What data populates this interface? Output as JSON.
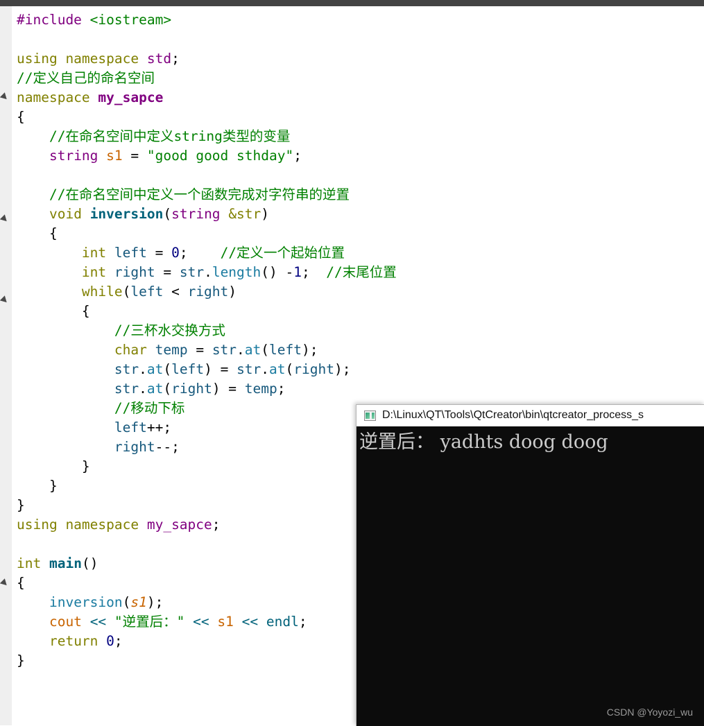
{
  "editor": {
    "background_color": "#ffffff",
    "gutter_color": "#efefef",
    "top_strip_color": "#434343",
    "fold_markers": [
      140,
      316,
      433,
      841
    ],
    "code_lines": [
      {
        "id": "l1",
        "segments": [
          {
            "c": "t-pre",
            "t": "#include"
          },
          {
            "c": "t-op",
            "t": " "
          },
          {
            "c": "t-inc",
            "t": "<iostream>"
          }
        ]
      },
      {
        "id": "l2",
        "segments": []
      },
      {
        "id": "l3",
        "segments": [
          {
            "c": "t-kw",
            "t": "using namespace "
          },
          {
            "c": "t-type",
            "t": "std"
          },
          {
            "c": "t-punc",
            "t": ";"
          }
        ]
      },
      {
        "id": "l4",
        "segments": [
          {
            "c": "t-cmt",
            "t": "//定义自己的命名空间"
          }
        ]
      },
      {
        "id": "l5",
        "segments": [
          {
            "c": "t-kw",
            "t": "namespace "
          },
          {
            "c": "t-ns",
            "t": "my_sapce"
          }
        ]
      },
      {
        "id": "l6",
        "segments": [
          {
            "c": "t-punc",
            "t": "{"
          }
        ]
      },
      {
        "id": "l7",
        "segments": [
          {
            "c": "t-cmt",
            "t": "    //在命名空间中定义string类型的变量"
          }
        ]
      },
      {
        "id": "l8",
        "segments": [
          {
            "c": "t-op",
            "t": "    "
          },
          {
            "c": "t-type",
            "t": "string"
          },
          {
            "c": "t-op",
            "t": " "
          },
          {
            "c": "t-var",
            "t": "s1"
          },
          {
            "c": "t-op",
            "t": " = "
          },
          {
            "c": "t-str",
            "t": "\"good good sthday\""
          },
          {
            "c": "t-punc",
            "t": ";"
          }
        ]
      },
      {
        "id": "l9",
        "segments": []
      },
      {
        "id": "l10",
        "segments": [
          {
            "c": "t-cmt",
            "t": "    //在命名空间中定义一个函数完成对字符串的逆置"
          }
        ]
      },
      {
        "id": "l11",
        "segments": [
          {
            "c": "t-op",
            "t": "    "
          },
          {
            "c": "t-kw",
            "t": "void"
          },
          {
            "c": "t-op",
            "t": " "
          },
          {
            "c": "t-fn",
            "t": "inversion"
          },
          {
            "c": "t-punc",
            "t": "("
          },
          {
            "c": "t-type",
            "t": "string"
          },
          {
            "c": "t-op",
            "t": " "
          },
          {
            "c": "t-kw",
            "t": "&str"
          },
          {
            "c": "t-punc",
            "t": ")"
          }
        ]
      },
      {
        "id": "l12",
        "segments": [
          {
            "c": "t-punc",
            "t": "    {"
          }
        ]
      },
      {
        "id": "l13",
        "segments": [
          {
            "c": "t-op",
            "t": "        "
          },
          {
            "c": "t-kw",
            "t": "int"
          },
          {
            "c": "t-op",
            "t": " "
          },
          {
            "c": "t-id",
            "t": "left"
          },
          {
            "c": "t-op",
            "t": " = "
          },
          {
            "c": "t-num",
            "t": "0"
          },
          {
            "c": "t-punc",
            "t": ";"
          },
          {
            "c": "t-op",
            "t": "    "
          },
          {
            "c": "t-cmt",
            "t": "//定义一个起始位置"
          }
        ]
      },
      {
        "id": "l14",
        "segments": [
          {
            "c": "t-op",
            "t": "        "
          },
          {
            "c": "t-kw",
            "t": "int"
          },
          {
            "c": "t-op",
            "t": " "
          },
          {
            "c": "t-id",
            "t": "right"
          },
          {
            "c": "t-op",
            "t": " = "
          },
          {
            "c": "t-id",
            "t": "str"
          },
          {
            "c": "t-punc",
            "t": "."
          },
          {
            "c": "t-fnc",
            "t": "length"
          },
          {
            "c": "t-punc",
            "t": "()"
          },
          {
            "c": "t-op",
            "t": " -"
          },
          {
            "c": "t-num",
            "t": "1"
          },
          {
            "c": "t-punc",
            "t": ";"
          },
          {
            "c": "t-op",
            "t": "  "
          },
          {
            "c": "t-cmt",
            "t": "//末尾位置"
          }
        ]
      },
      {
        "id": "l15",
        "segments": [
          {
            "c": "t-op",
            "t": "        "
          },
          {
            "c": "t-kw",
            "t": "while"
          },
          {
            "c": "t-punc",
            "t": "("
          },
          {
            "c": "t-id",
            "t": "left"
          },
          {
            "c": "t-op",
            "t": " < "
          },
          {
            "c": "t-id",
            "t": "right"
          },
          {
            "c": "t-punc",
            "t": ")"
          }
        ]
      },
      {
        "id": "l16",
        "segments": [
          {
            "c": "t-punc",
            "t": "        {"
          }
        ]
      },
      {
        "id": "l17",
        "segments": [
          {
            "c": "t-cmt",
            "t": "            //三杯水交换方式"
          }
        ]
      },
      {
        "id": "l18",
        "segments": [
          {
            "c": "t-op",
            "t": "            "
          },
          {
            "c": "t-kw",
            "t": "char"
          },
          {
            "c": "t-op",
            "t": " "
          },
          {
            "c": "t-id",
            "t": "temp"
          },
          {
            "c": "t-op",
            "t": " = "
          },
          {
            "c": "t-id",
            "t": "str"
          },
          {
            "c": "t-punc",
            "t": "."
          },
          {
            "c": "t-fnc",
            "t": "at"
          },
          {
            "c": "t-punc",
            "t": "("
          },
          {
            "c": "t-id",
            "t": "left"
          },
          {
            "c": "t-punc",
            "t": ");"
          }
        ]
      },
      {
        "id": "l19",
        "segments": [
          {
            "c": "t-op",
            "t": "            "
          },
          {
            "c": "t-id",
            "t": "str"
          },
          {
            "c": "t-punc",
            "t": "."
          },
          {
            "c": "t-fnc",
            "t": "at"
          },
          {
            "c": "t-punc",
            "t": "("
          },
          {
            "c": "t-id",
            "t": "left"
          },
          {
            "c": "t-punc",
            "t": ")"
          },
          {
            "c": "t-op",
            "t": " = "
          },
          {
            "c": "t-id",
            "t": "str"
          },
          {
            "c": "t-punc",
            "t": "."
          },
          {
            "c": "t-fnc",
            "t": "at"
          },
          {
            "c": "t-punc",
            "t": "("
          },
          {
            "c": "t-id",
            "t": "right"
          },
          {
            "c": "t-punc",
            "t": ");"
          }
        ]
      },
      {
        "id": "l20",
        "segments": [
          {
            "c": "t-op",
            "t": "            "
          },
          {
            "c": "t-id",
            "t": "str"
          },
          {
            "c": "t-punc",
            "t": "."
          },
          {
            "c": "t-fnc",
            "t": "at"
          },
          {
            "c": "t-punc",
            "t": "("
          },
          {
            "c": "t-id",
            "t": "right"
          },
          {
            "c": "t-punc",
            "t": ")"
          },
          {
            "c": "t-op",
            "t": " = "
          },
          {
            "c": "t-id",
            "t": "temp"
          },
          {
            "c": "t-punc",
            "t": ";"
          }
        ]
      },
      {
        "id": "l21",
        "segments": [
          {
            "c": "t-cmt",
            "t": "            //移动下标"
          }
        ]
      },
      {
        "id": "l22",
        "segments": [
          {
            "c": "t-op",
            "t": "            "
          },
          {
            "c": "t-id",
            "t": "left"
          },
          {
            "c": "t-punc",
            "t": "++;"
          }
        ]
      },
      {
        "id": "l23",
        "segments": [
          {
            "c": "t-op",
            "t": "            "
          },
          {
            "c": "t-id",
            "t": "right"
          },
          {
            "c": "t-punc",
            "t": "--;"
          }
        ]
      },
      {
        "id": "l24",
        "segments": [
          {
            "c": "t-punc",
            "t": "        }"
          }
        ]
      },
      {
        "id": "l25",
        "segments": [
          {
            "c": "t-punc",
            "t": "    }"
          }
        ]
      },
      {
        "id": "l26",
        "segments": [
          {
            "c": "t-punc",
            "t": "}"
          }
        ]
      },
      {
        "id": "l27",
        "segments": [
          {
            "c": "t-kw",
            "t": "using namespace "
          },
          {
            "c": "t-nsu",
            "t": "my_sapce"
          },
          {
            "c": "t-punc",
            "t": ";"
          }
        ]
      },
      {
        "id": "l28",
        "segments": []
      },
      {
        "id": "l29",
        "segments": [
          {
            "c": "t-kw",
            "t": "int"
          },
          {
            "c": "t-op",
            "t": " "
          },
          {
            "c": "t-fn",
            "t": "main"
          },
          {
            "c": "t-punc",
            "t": "()"
          }
        ]
      },
      {
        "id": "l30",
        "segments": [
          {
            "c": "t-punc",
            "t": "{"
          }
        ]
      },
      {
        "id": "l31",
        "segments": [
          {
            "c": "t-op",
            "t": "    "
          },
          {
            "c": "t-fnc",
            "t": "inversion"
          },
          {
            "c": "t-punc",
            "t": "("
          },
          {
            "c": "t-varit",
            "t": "s1"
          },
          {
            "c": "t-punc",
            "t": ");"
          }
        ]
      },
      {
        "id": "l32",
        "segments": [
          {
            "c": "t-op",
            "t": "    "
          },
          {
            "c": "t-var",
            "t": "cout"
          },
          {
            "c": "t-op",
            "t": " "
          },
          {
            "c": "t-teal",
            "t": "<<"
          },
          {
            "c": "t-op",
            "t": " "
          },
          {
            "c": "t-str",
            "t": "\"逆置后："
          },
          {
            "c": "t-str",
            "t": "\""
          },
          {
            "c": "t-op",
            "t": " "
          },
          {
            "c": "t-teal",
            "t": "<<"
          },
          {
            "c": "t-op",
            "t": " "
          },
          {
            "c": "t-var",
            "t": "s1"
          },
          {
            "c": "t-op",
            "t": " "
          },
          {
            "c": "t-teal",
            "t": "<<"
          },
          {
            "c": "t-op",
            "t": " "
          },
          {
            "c": "t-teal",
            "t": "endl"
          },
          {
            "c": "t-punc",
            "t": ";"
          }
        ]
      },
      {
        "id": "l33",
        "segments": [
          {
            "c": "t-op",
            "t": "    "
          },
          {
            "c": "t-kw",
            "t": "return"
          },
          {
            "c": "t-op",
            "t": " "
          },
          {
            "c": "t-num",
            "t": "0"
          },
          {
            "c": "t-punc",
            "t": ";"
          }
        ]
      },
      {
        "id": "l34",
        "segments": [
          {
            "c": "t-punc",
            "t": "}"
          }
        ]
      }
    ],
    "plain_text": "#include <iostream>\n\nusing namespace std;\n//定义自己的命名空间\nnamespace my_sapce\n{\n    //在命名空间中定义string类型的变量\n    string s1 = \"good good sthday\";\n\n    //在命名空间中定义一个函数完成对字符串的逆置\n    void inversion(string &str)\n    {\n        int left = 0;    //定义一个起始位置\n        int right = str.length() -1;  //末尾位置\n        while(left < right)\n        {\n            //三杯水交换方式\n            char temp = str.at(left);\n            str.at(left) = str.at(right);\n            str.at(right) = temp;\n            //移动下标\n            left++;\n            right--;\n        }\n    }\n}\nusing namespace my_sapce;\n\nint main()\n{\n    inversion(s1);\n    cout << \"逆置后：\" << s1 << endl;\n    return 0;\n}"
  },
  "console": {
    "icon": "console-window-icon",
    "title": "D:\\Linux\\QT\\Tools\\QtCreator\\bin\\qtcreator_process_s",
    "output_line": "逆置后： yadhts doog doog",
    "watermark": "CSDN @Yoyozi_wu",
    "background_color": "#0c0c0c",
    "text_color": "#cccccc"
  }
}
